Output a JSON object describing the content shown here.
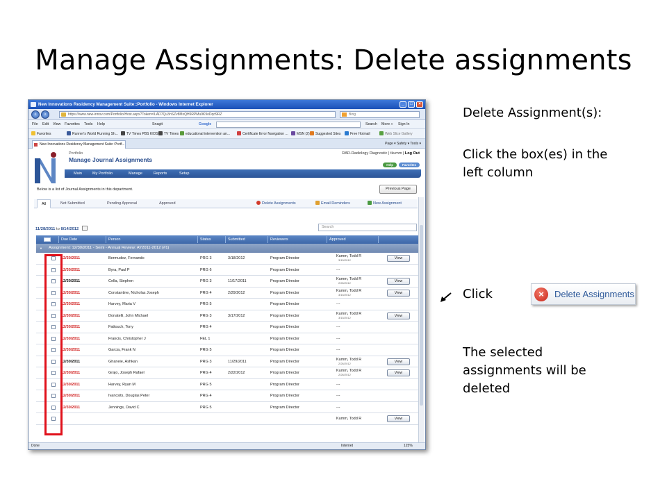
{
  "slide": {
    "title": "Manage Assignments:  Delete assignments",
    "instructions": {
      "heading": "Delete Assignment(s):",
      "step1": "Click the box(es) in the left column",
      "click_label": "Click",
      "button_callout": "Delete Assignments",
      "result": "The selected assignments will be deleted"
    }
  },
  "browser": {
    "window_title": "New Innovations Residency Management Suite::Portfolio - Windows Internet Explorer",
    "url": "https://www.new-innov.com/Portfolio/Host.aspx?Token=ILAD7Qu3nSZv8MxQH9RPMu9K9oDqd9RZ",
    "search_placeholder": "Bing",
    "menu": [
      "File",
      "Edit",
      "View",
      "Favorites",
      "Tools",
      "Help"
    ],
    "snagit": "Snagit",
    "google": "Google",
    "google_right": [
      "Search",
      "More »",
      "Sign In"
    ],
    "favorites_label": "Favorites",
    "favorites": [
      "Runner's World Running Sh...",
      "TV Times PBS KIDS",
      "TV Times",
      "educational intervention an...",
      "Certificate Error Navigation ...",
      "MSN (2)",
      "Suggested Sites",
      "Free Hotmail",
      "Web Slice Gallery"
    ],
    "tab_title": "New Innovations Residency Management Suite::Portf...",
    "command_bar": "Page ▾  Safety ▾  Tools ▾",
    "status": {
      "left": "Done",
      "zone": "Internet",
      "zoom": "125%"
    }
  },
  "app": {
    "breadcrumb": "Portfolio",
    "title": "Manage Journal Assignments",
    "user": {
      "dept": "RAD-Radiology Diagnostic",
      "username": "tkumm",
      "logout": "Log Out"
    },
    "help": "Help",
    "favorites_btn": "Favorites",
    "nav": [
      "Main",
      "My Portfolio",
      "Manage",
      "Reports",
      "Setup"
    ],
    "intro": "Below is a list of Journal Assignments in this department.",
    "prev_page": "Previous Page",
    "filter_tabs": [
      "All",
      "Not Submitted",
      "Pending Approval",
      "Approved"
    ],
    "actions": {
      "delete": "Delete Assignments",
      "email": "Email Reminders",
      "new": "New Assignment"
    },
    "date_from": "11/28/2011",
    "date_to_word": "to",
    "date_to": "8/14/2012",
    "search_placeholder": "Search",
    "columns": [
      "Due Date",
      "Person",
      "Status",
      "Submitted",
      "Reviewers",
      "Approved"
    ],
    "group_label": "Assignment: 12/30/2011 - Semi - Annual Review: AY2011-2012 (#1)",
    "view_label": "View",
    "rows": [
      {
        "due": "12/30/2011",
        "late": true,
        "person": "Bermudez, Fernando",
        "status": "PRG 3",
        "submitted": "3/18/2012",
        "reviewer": "Program Director",
        "approved": "Kumm, Todd R",
        "approved_date": "3/15/2012",
        "view": true
      },
      {
        "due": "12/30/2011",
        "late": true,
        "person": "Byra, Paul P",
        "status": "PRG 6",
        "submitted": "",
        "reviewer": "Program Director",
        "approved": "---",
        "approved_date": "",
        "view": false
      },
      {
        "due": "12/30/2011",
        "late": false,
        "person": "Cella, Stephen",
        "status": "PRG 3",
        "submitted": "11/17/2011",
        "reviewer": "Program Director",
        "approved": "Kumm, Todd R",
        "approved_date": "2/26/2012",
        "view": true
      },
      {
        "due": "12/30/2011",
        "late": true,
        "person": "Constantine, Nicholas Joseph",
        "status": "PRG 4",
        "submitted": "2/29/2012",
        "reviewer": "Program Director",
        "approved": "Kumm, Todd R",
        "approved_date": "3/15/2012",
        "view": true
      },
      {
        "due": "12/30/2011",
        "late": true,
        "person": "Harvey, Maria V",
        "status": "PRG 5",
        "submitted": "",
        "reviewer": "Program Director",
        "approved": "---",
        "approved_date": "",
        "view": false
      },
      {
        "due": "12/30/2011",
        "late": true,
        "person": "Donatelli, John Michael",
        "status": "PRG 3",
        "submitted": "3/17/2012",
        "reviewer": "Program Director",
        "approved": "Kumm, Todd R",
        "approved_date": "3/15/2012",
        "view": true
      },
      {
        "due": "12/30/2011",
        "late": true,
        "person": "Fattouch, Tony",
        "status": "PRG 4",
        "submitted": "",
        "reviewer": "Program Director",
        "approved": "---",
        "approved_date": "",
        "view": false
      },
      {
        "due": "12/30/2011",
        "late": true,
        "person": "Francis, Christopher J",
        "status": "FEL 1",
        "submitted": "",
        "reviewer": "Program Director",
        "approved": "---",
        "approved_date": "",
        "view": false
      },
      {
        "due": "12/30/2011",
        "late": true,
        "person": "Garcia, Frank N",
        "status": "PRG 5",
        "submitted": "",
        "reviewer": "Program Director",
        "approved": "---",
        "approved_date": "",
        "view": false
      },
      {
        "due": "12/30/2011",
        "late": false,
        "person": "Ghaneie, Ashkan",
        "status": "PRG 3",
        "submitted": "11/29/2011",
        "reviewer": "Program Director",
        "approved": "Kumm, Todd R",
        "approved_date": "2/26/2012",
        "view": true
      },
      {
        "due": "12/30/2011",
        "late": true,
        "person": "Grajo, Joseph Rafael",
        "status": "PRG 4",
        "submitted": "2/22/2012",
        "reviewer": "Program Director",
        "approved": "Kumm, Todd R",
        "approved_date": "2/26/2012",
        "view": true
      },
      {
        "due": "12/30/2011",
        "late": true,
        "person": "Harvey, Ryan M",
        "status": "PRG 5",
        "submitted": "",
        "reviewer": "Program Director",
        "approved": "---",
        "approved_date": "",
        "view": false
      },
      {
        "due": "12/30/2011",
        "late": true,
        "person": "Ivancsits, Douglas Peter",
        "status": "PRG 4",
        "submitted": "",
        "reviewer": "Program Director",
        "approved": "---",
        "approved_date": "",
        "view": false
      },
      {
        "due": "12/30/2011",
        "late": true,
        "person": "Jennings, David C",
        "status": "PRG 5",
        "submitted": "",
        "reviewer": "Program Director",
        "approved": "---",
        "approved_date": "",
        "view": false
      },
      {
        "due": "",
        "late": true,
        "person": "",
        "status": "",
        "submitted": "",
        "reviewer": "",
        "approved": "Kumm, Todd R",
        "approved_date": "",
        "view": true
      }
    ]
  },
  "colors": {
    "accent": "#2a4e8e",
    "late_date": "#d02020",
    "highlight": "#e0101a"
  }
}
